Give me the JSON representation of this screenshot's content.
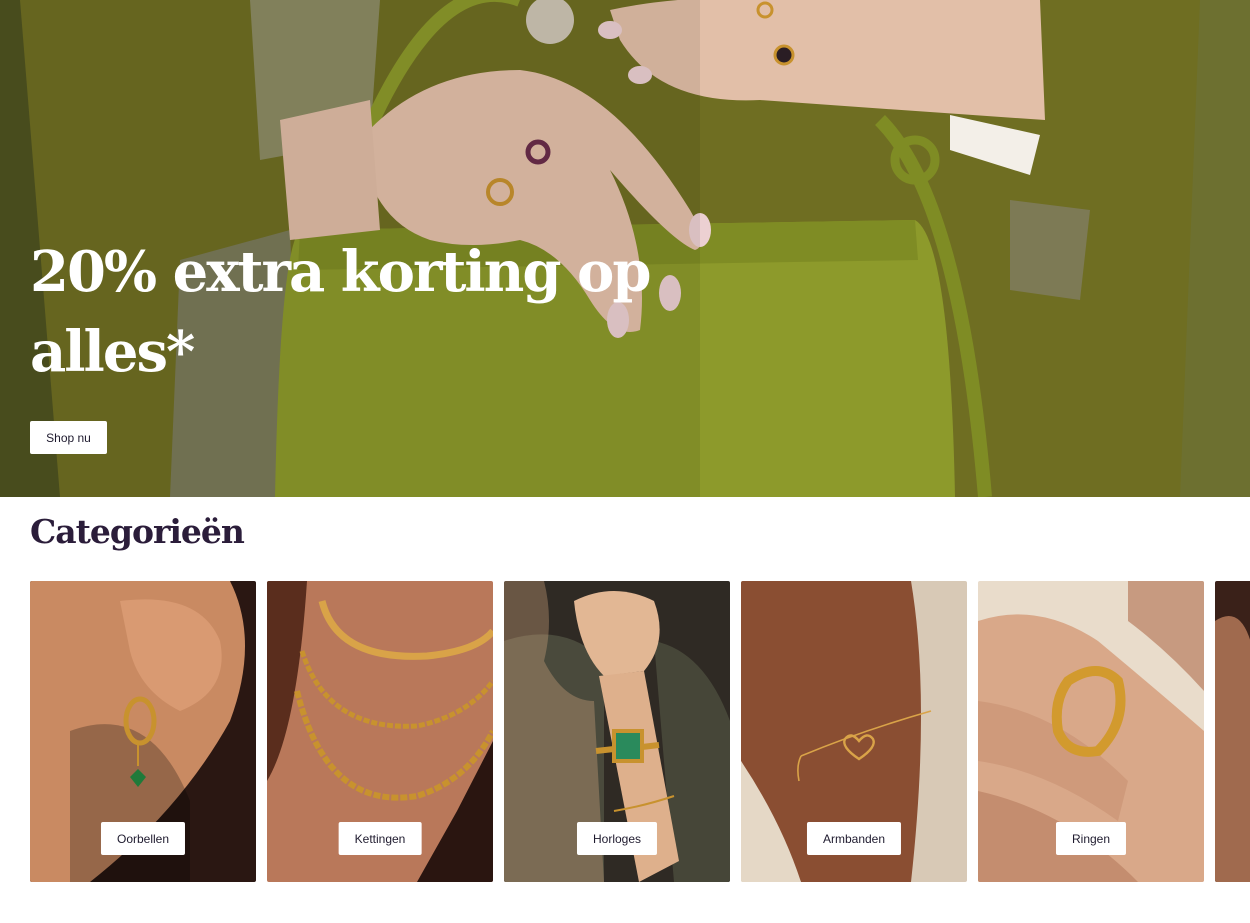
{
  "hero": {
    "title": "20% extra korting op alles*",
    "cta_label": "Shop nu"
  },
  "categories": {
    "heading": "Categorieën",
    "items": [
      {
        "label": "Oorbellen",
        "image": "earring-photo"
      },
      {
        "label": "Kettingen",
        "image": "necklace-photo"
      },
      {
        "label": "Horloges",
        "image": "watch-photo"
      },
      {
        "label": "Armbanden",
        "image": "bracelet-photo"
      },
      {
        "label": "Ringen",
        "image": "ring-photo"
      }
    ]
  },
  "colors": {
    "heading_text": "#2b1d3a",
    "hero_bg": "#5d6122",
    "bag": "#8a9a2a",
    "gold": "#c8922e"
  }
}
